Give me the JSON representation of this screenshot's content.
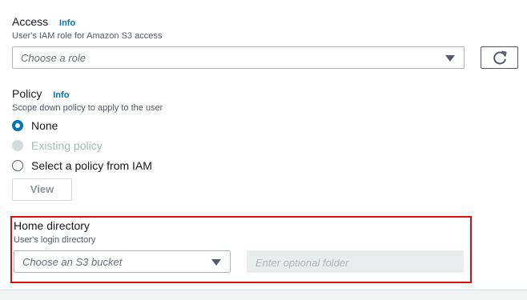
{
  "access": {
    "label": "Access",
    "info": "Info",
    "description": "User's IAM role for Amazon S3 access",
    "role_placeholder": "Choose a role"
  },
  "policy": {
    "label": "Policy",
    "info": "Info",
    "description": "Scope down policy to apply to the user",
    "options": [
      {
        "label": "None",
        "state": "checked"
      },
      {
        "label": "Existing policy",
        "state": "disabled"
      },
      {
        "label": "Select a policy from IAM",
        "state": "unchecked"
      }
    ],
    "view_button": "View"
  },
  "home_directory": {
    "label": "Home directory",
    "description": "User's login directory",
    "bucket_placeholder": "Choose an S3 bucket",
    "folder_placeholder": "Enter optional folder"
  },
  "colors": {
    "info_link": "#0073bb",
    "radio_checked": "#0073bb",
    "highlight_border": "#e30c0c"
  },
  "icons": [
    "refresh-icon",
    "caret-down-icon"
  ]
}
